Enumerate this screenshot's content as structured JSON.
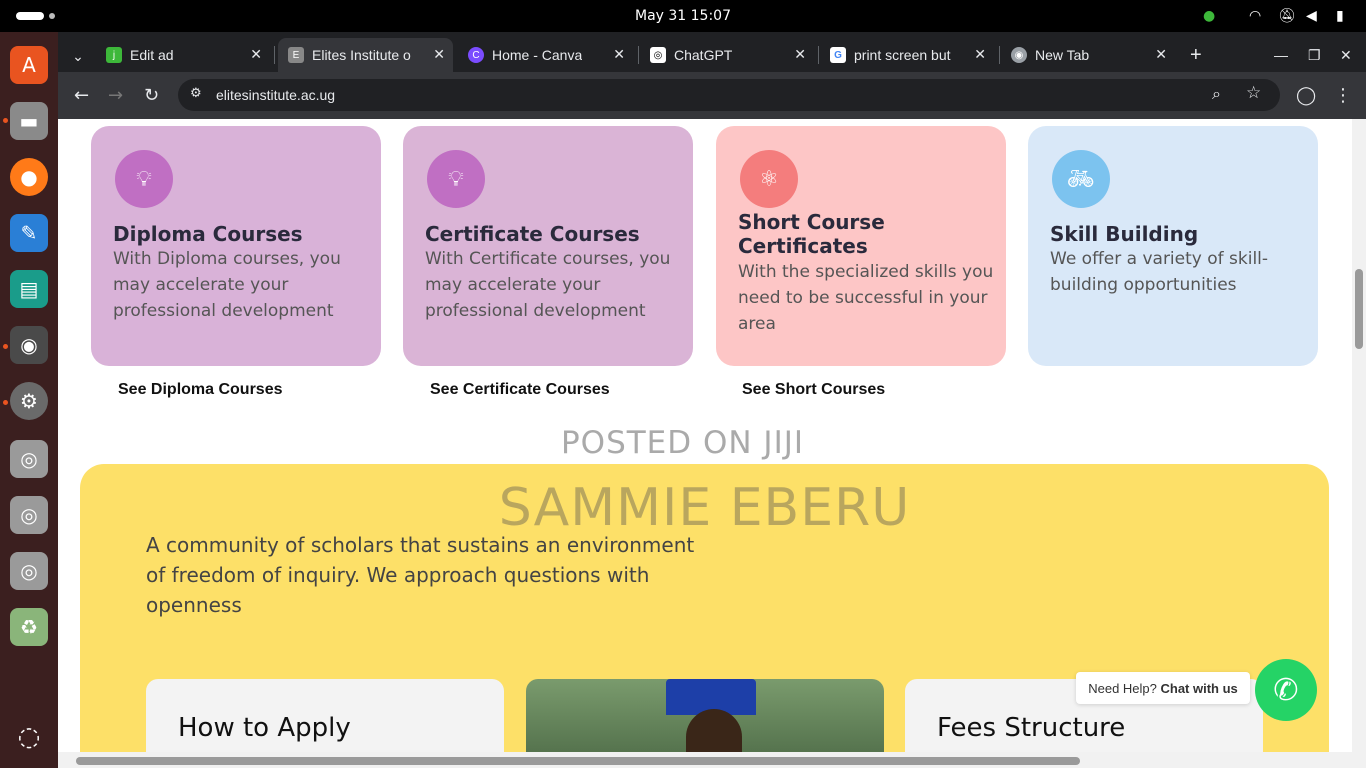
{
  "topbar": {
    "clock": "May 31  15:07"
  },
  "tabs": [
    {
      "title": "Edit ad",
      "favicon": "jiji-icon",
      "color": "#3db83a",
      "glyph": "jiji"
    },
    {
      "title": "Elites Institute o",
      "favicon": "elites-icon",
      "color": "#777777",
      "glyph": "E"
    },
    {
      "title": "Home - Canva",
      "favicon": "canva-icon",
      "color": "#7b4cff",
      "glyph": "C"
    },
    {
      "title": "ChatGPT",
      "favicon": "chatgpt-icon",
      "color": "#ffffff",
      "glyph": "◎"
    },
    {
      "title": "print screen but",
      "favicon": "google-icon",
      "color": "#ffffff",
      "glyph": "G"
    },
    {
      "title": "New Tab",
      "favicon": "chrome-icon",
      "color": "#9aa0a6",
      "glyph": "◉"
    }
  ],
  "address": {
    "url": "elitesinstitute.ac.ug"
  },
  "cards": [
    {
      "title_lines": [
        "Diploma Courses"
      ],
      "description": "With Diploma courses, you may accelerate your professional development",
      "bg": "#d9b2d8",
      "badge_color": "#c06fc3",
      "icon": "lightbulb-icon",
      "glyph": "💡"
    },
    {
      "title_lines": [
        "Certificate Courses"
      ],
      "description": "With Certificate courses, you may accelerate your professional development",
      "bg": "#dab4d6",
      "badge_color": "#c06fc3",
      "icon": "lightbulb-icon",
      "glyph": "💡"
    },
    {
      "title_lines": [
        "Short Course",
        "Certificates"
      ],
      "description": "With the specialized skills you need to be successful in your area",
      "bg": "#fdc6c6",
      "badge_color": "#f47d7d",
      "icon": "atom-icon",
      "glyph": "⚛"
    },
    {
      "title_lines": [
        "Skill Building"
      ],
      "description": "We offer a variety of skill-building opportunities",
      "bg": "#d9e8f8",
      "badge_color": "#7cc3ef",
      "icon": "bicycle-icon",
      "glyph": "🚲"
    }
  ],
  "links": [
    "See Diploma Courses",
    "See Certificate Courses",
    "See Short Courses"
  ],
  "watermark": {
    "line1": "POSTED ON JIJI",
    "line2": "SAMMIE EBERU"
  },
  "about": {
    "mission": "A community of scholars that sustains an environment of freedom of inquiry. We approach questions with openness"
  },
  "bottom_cards": {
    "apply": "How to Apply",
    "fees": "Fees Structure"
  },
  "help": {
    "prefix": "Need Help? ",
    "action": "Chat with us"
  }
}
